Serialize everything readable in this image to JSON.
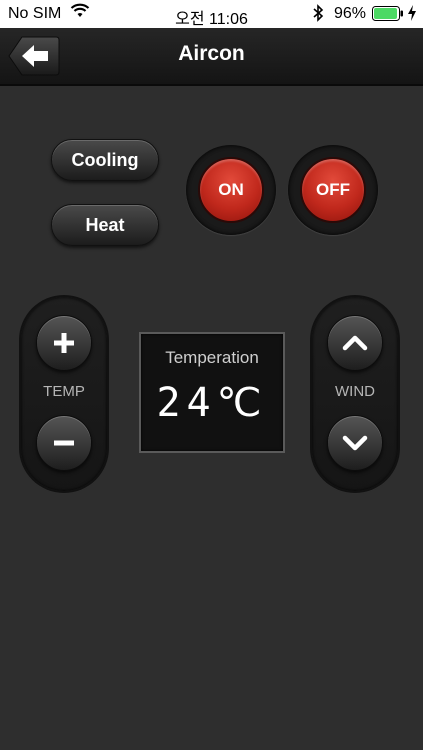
{
  "status_bar": {
    "carrier": "No SIM",
    "time": "오전 11:06",
    "battery_percent": "96%",
    "battery_level": 0.96
  },
  "navbar": {
    "title": "Aircon"
  },
  "modes": {
    "cooling": "Cooling",
    "heat": "Heat"
  },
  "power": {
    "on": "ON",
    "off": "OFF"
  },
  "temp_control": {
    "label": "TEMP"
  },
  "wind_control": {
    "label": "WIND"
  },
  "display": {
    "label": "Temperation",
    "value": "24℃"
  },
  "colors": {
    "background": "#2e2e2e",
    "power_red": "#c0281c",
    "battery_green": "#4cd964"
  },
  "icons": {
    "back": "arrow-left-icon",
    "plus": "plus-icon",
    "minus": "minus-icon",
    "up": "chevron-up-icon",
    "down": "chevron-down-icon"
  }
}
